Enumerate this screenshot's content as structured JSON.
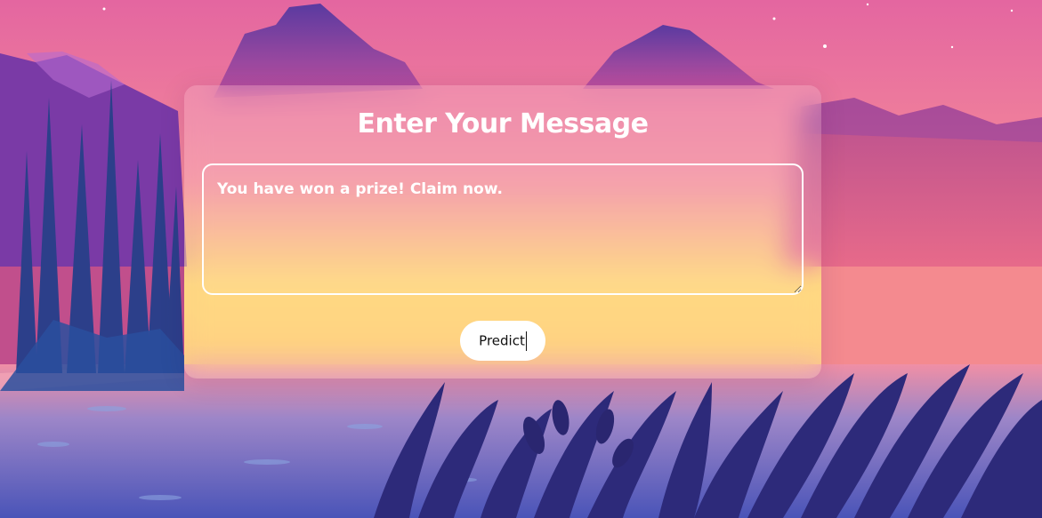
{
  "page": {
    "heading": "Enter Your Message"
  },
  "form": {
    "message_value": "You have won a prize! Claim now.",
    "predict_label": "Predict"
  },
  "background": {
    "description_icon": "sunset-lake-landscape",
    "sky_top_color": "#e96aa0",
    "sky_horizon_color": "#ffd66b",
    "mountain_color": "#6c3fa8",
    "water_color": "#5b62c2",
    "foliage_color": "#2f2a7a"
  }
}
